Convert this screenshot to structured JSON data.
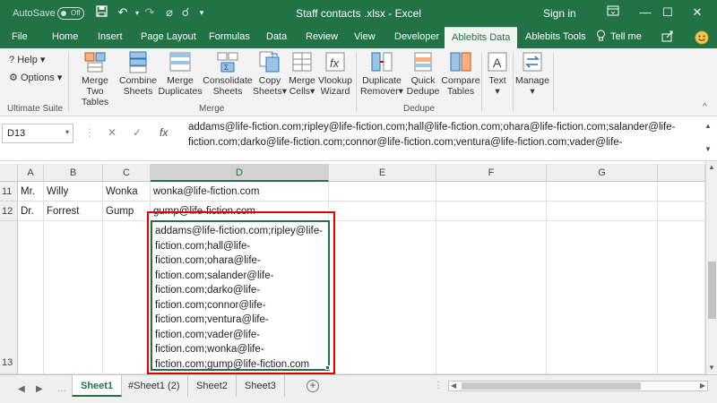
{
  "titlebar": {
    "autosave_label": "AutoSave",
    "autosave_state": "Off",
    "title": "Staff contacts .xlsx  -  Excel",
    "signin": "Sign in"
  },
  "ribbon_tabs": [
    {
      "label": "File"
    },
    {
      "label": "Home"
    },
    {
      "label": "Insert"
    },
    {
      "label": "Page Layout"
    },
    {
      "label": "Formulas"
    },
    {
      "label": "Data"
    },
    {
      "label": "Review"
    },
    {
      "label": "View"
    },
    {
      "label": "Developer"
    },
    {
      "label": "Ablebits Data",
      "active": true
    },
    {
      "label": "Ablebits Tools"
    },
    {
      "label": "Tell me"
    }
  ],
  "ribbon": {
    "help": "Help",
    "options": "Options",
    "ultimate_suite": "Ultimate Suite",
    "merge_group": "Merge",
    "dedupe_group": "Dedupe",
    "items": {
      "merge_two_tables": [
        "Merge",
        "Two Tables"
      ],
      "combine_sheets": [
        "Combine",
        "Sheets"
      ],
      "merge_duplicates": [
        "Merge",
        "Duplicates"
      ],
      "consolidate_sheets": [
        "Consolidate",
        "Sheets"
      ],
      "copy_sheets": [
        "Copy",
        "Sheets"
      ],
      "merge_cells": [
        "Merge",
        "Cells"
      ],
      "vlookup_wizard": [
        "Vlookup",
        "Wizard"
      ],
      "duplicate_remover": [
        "Duplicate",
        "Remover"
      ],
      "quick_dedupe": [
        "Quick",
        "Dedupe"
      ],
      "compare_tables": [
        "Compare",
        "Tables"
      ],
      "text": [
        "Text",
        ""
      ],
      "manage": [
        "Manage",
        ""
      ]
    }
  },
  "formula_bar": {
    "name_box": "D13",
    "fx": "fx",
    "content": "addams@life-fiction.com;ripley@life-fiction.com;hall@life-fiction.com;ohara@life-fiction.com;salander@life-fiction.com;darko@life-fiction.com;connor@life-fiction.com;ventura@life-fiction.com;vader@life-"
  },
  "grid": {
    "columns": [
      "A",
      "B",
      "C",
      "D",
      "E",
      "F",
      "G"
    ],
    "rows": [
      {
        "num": "11",
        "a": "Mr.",
        "b": "Willy",
        "c": "Wonka",
        "d": "wonka@life-fiction.com"
      },
      {
        "num": "12",
        "a": "Dr.",
        "b": "Forrest",
        "c": "Gump",
        "d": "gump@life-fiction.com"
      },
      {
        "num": "13",
        "a": "",
        "b": "",
        "c": "",
        "d": "addams@life-fiction.com;ripley@life-fiction.com;hall@life-fiction.com;ohara@life-fiction.com;salander@life-fiction.com;darko@life-fiction.com;connor@life-fiction.com;ventura@life-fiction.com;vader@life-fiction.com;wonka@life-fiction.com;gump@life-fiction.com"
      }
    ]
  },
  "sheets": [
    {
      "label": "Sheet1",
      "active": true
    },
    {
      "label": "#Sheet1 (2)"
    },
    {
      "label": "Sheet2"
    },
    {
      "label": "Sheet3"
    }
  ],
  "colors": {
    "excel_green": "#217346",
    "highlight_red": "#e00000"
  }
}
